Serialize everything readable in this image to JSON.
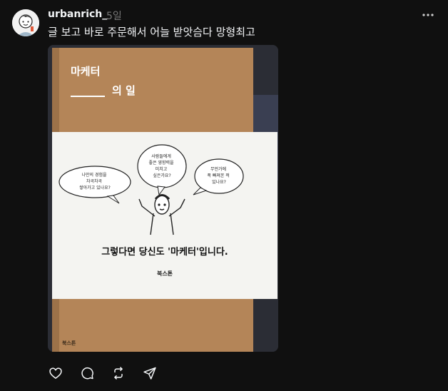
{
  "post": {
    "username": "urbanrich_",
    "time": "5일",
    "text": "글 보고 바로 주문해서 어늘 받앗슴다 망형최고"
  },
  "book": {
    "title_line1": "마케터",
    "title_line2": "의 일",
    "bubble_left": [
      "나만의 경험을",
      "차곡차곡",
      "쌓아가고 있나요?"
    ],
    "bubble_center": [
      "사람들에게",
      "좋은 영향력을",
      "미치고",
      "싶은가요?"
    ],
    "bubble_right": [
      "무언가에",
      "푹 빠져본 적",
      "있나요?"
    ],
    "band_slogan": "그렇다면 당신도 '마케터'입니다.",
    "publisher": "북스톤",
    "publisher_bottom": "북스톤"
  },
  "icons": {
    "more": "more-dots-icon",
    "like": "heart-icon",
    "comment": "comment-icon",
    "repost": "repost-icon",
    "share": "send-icon"
  },
  "colors": {
    "background": "#101010",
    "text": "#f3f5f7",
    "muted": "#777777",
    "cover": "#b9895a"
  }
}
